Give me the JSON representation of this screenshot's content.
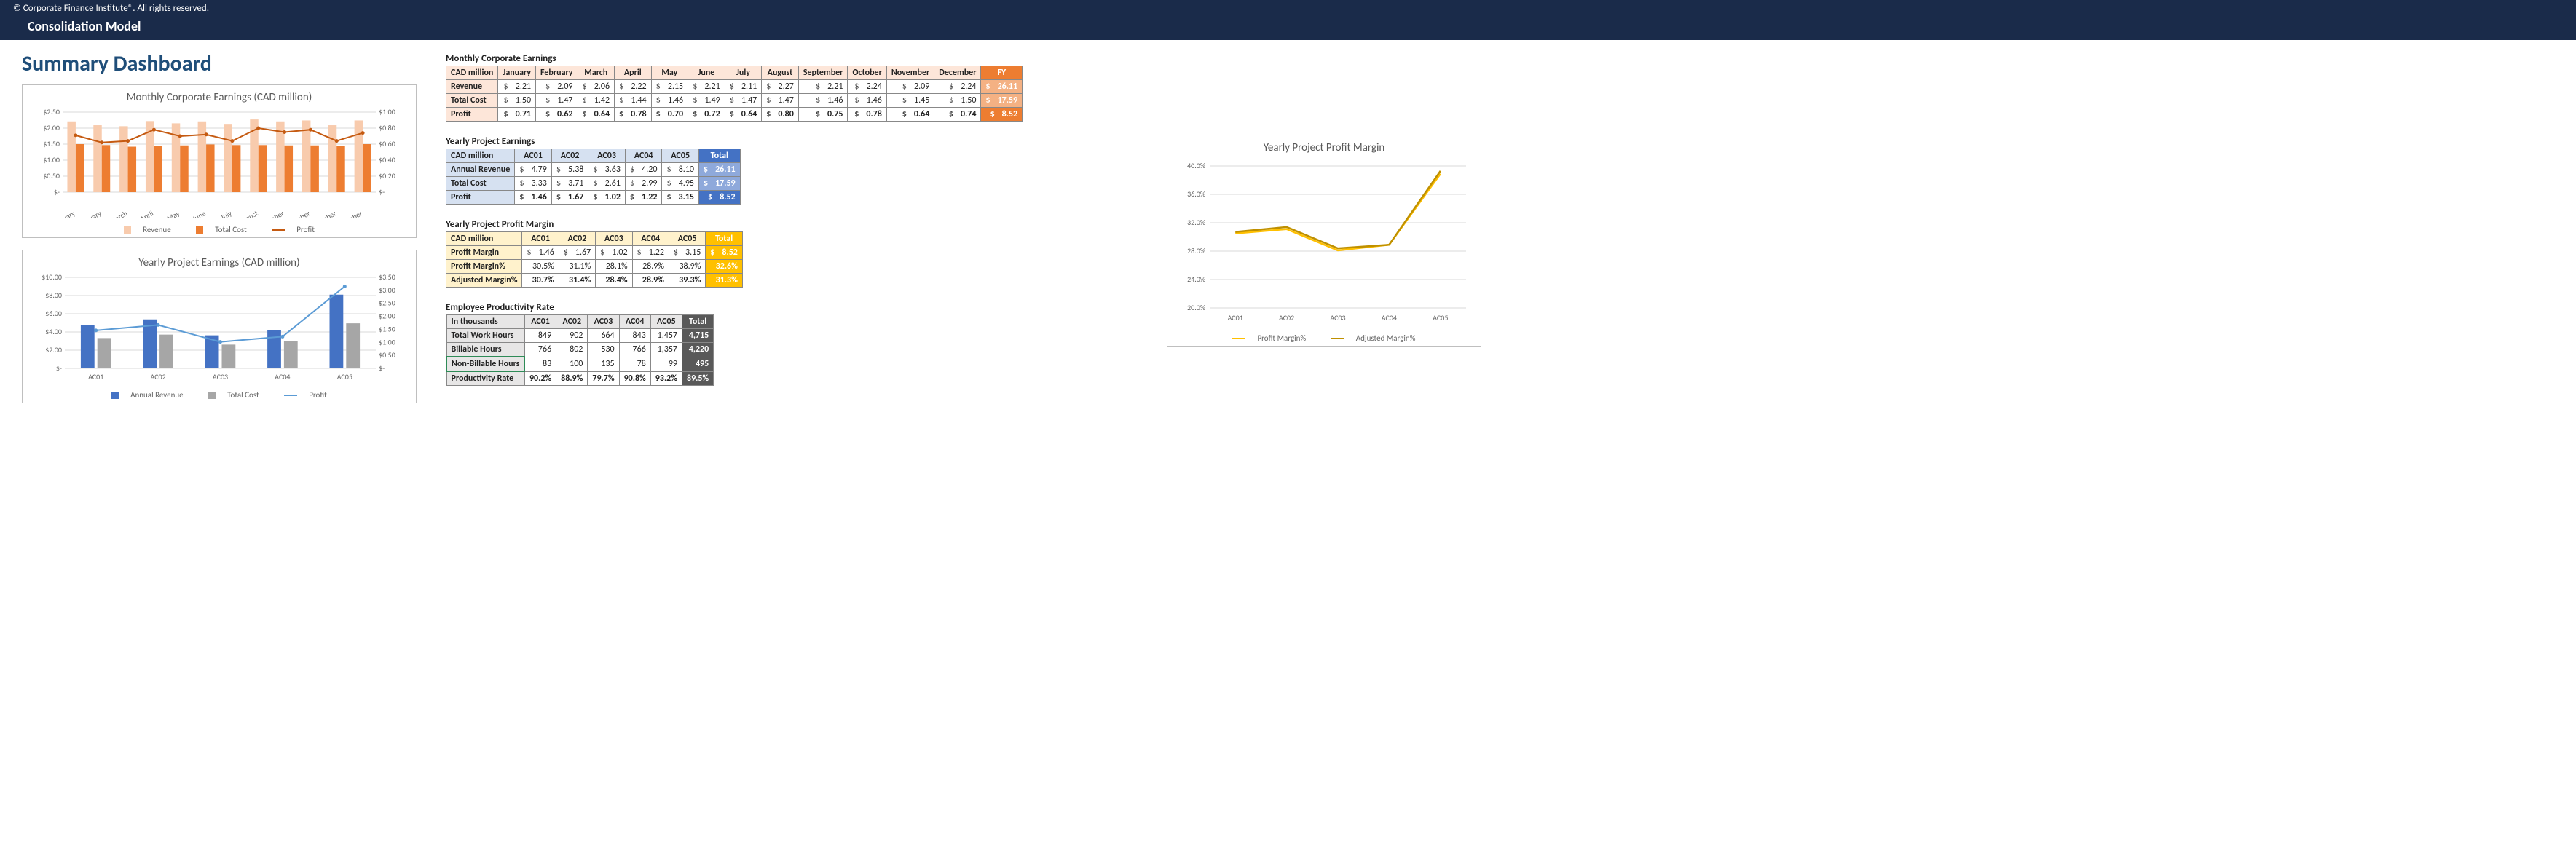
{
  "topbar": "© Corporate Finance Institute®. All rights reserved.",
  "subbar": "Consolidation Model",
  "page_title": "Summary Dashboard",
  "chart1": {
    "title": "Monthly Corporate Earnings (CAD million)",
    "legend": {
      "rev": "Revenue",
      "cost": "Total Cost",
      "profit": "Profit"
    },
    "left_ticks": [
      "$2.50",
      "$2.00",
      "$1.50",
      "$1.00",
      "$0.50",
      "$-"
    ],
    "right_ticks": [
      "$1.00",
      "$0.80",
      "$0.60",
      "$0.40",
      "$0.20",
      "$-"
    ]
  },
  "chart2": {
    "title": "Yearly Project Earnings (CAD million)",
    "legend": {
      "rev": "Annual Revenue",
      "cost": "Total Cost",
      "profit": "Profit"
    },
    "left_ticks": [
      "$10.00",
      "$8.00",
      "$6.00",
      "$4.00",
      "$2.00",
      "$-"
    ],
    "right_ticks": [
      "$3.50",
      "$3.00",
      "$2.50",
      "$2.00",
      "$1.50",
      "$1.00",
      "$0.50",
      "$-"
    ]
  },
  "chart3": {
    "title": "Yearly Project Profit Margin",
    "legend": {
      "pm": "Profit Margin%",
      "am": "Adjusted Margin%"
    },
    "y_ticks": [
      "40.0%",
      "36.0%",
      "32.0%",
      "28.0%",
      "24.0%",
      "20.0%"
    ]
  },
  "months": [
    "January",
    "February",
    "March",
    "April",
    "May",
    "June",
    "July",
    "August",
    "September",
    "October",
    "November",
    "December"
  ],
  "mce": {
    "title": "Monthly Corporate Earnings",
    "row_header": "CAD million",
    "fy_label": "FY",
    "rows": {
      "Revenue": [
        "2.21",
        "2.09",
        "2.06",
        "2.22",
        "2.15",
        "2.21",
        "2.11",
        "2.27",
        "2.21",
        "2.24",
        "2.09",
        "2.24"
      ],
      "Total Cost": [
        "1.50",
        "1.47",
        "1.42",
        "1.44",
        "1.46",
        "1.49",
        "1.47",
        "1.47",
        "1.46",
        "1.46",
        "1.45",
        "1.50"
      ],
      "Profit": [
        "0.71",
        "0.62",
        "0.64",
        "0.78",
        "0.70",
        "0.72",
        "0.64",
        "0.80",
        "0.75",
        "0.78",
        "0.64",
        "0.74"
      ]
    },
    "fy": {
      "Revenue": "26.11",
      "Total Cost": "17.59",
      "Profit": "8.52"
    }
  },
  "projects": [
    "AC01",
    "AC02",
    "AC03",
    "AC04",
    "AC05"
  ],
  "ype": {
    "title": "Yearly Project Earnings",
    "row_header": "CAD million",
    "total_label": "Total",
    "rows": {
      "Annual Revenue": [
        "4.79",
        "5.38",
        "3.63",
        "4.20",
        "8.10"
      ],
      "Total Cost": [
        "3.33",
        "3.71",
        "2.61",
        "2.99",
        "4.95"
      ],
      "Profit": [
        "1.46",
        "1.67",
        "1.02",
        "1.22",
        "3.15"
      ]
    },
    "totals": {
      "Annual Revenue": "26.11",
      "Total Cost": "17.59",
      "Profit": "8.52"
    }
  },
  "ypm": {
    "title": "Yearly Project Profit Margin",
    "row_header": "CAD million",
    "total_label": "Total",
    "rows": {
      "Profit Margin": [
        "1.46",
        "1.67",
        "1.02",
        "1.22",
        "3.15"
      ],
      "Profit Margin%": [
        "30.5%",
        "31.1%",
        "28.1%",
        "28.9%",
        "38.9%"
      ],
      "Adjusted Margin%": [
        "30.7%",
        "31.4%",
        "28.4%",
        "28.9%",
        "39.3%"
      ]
    },
    "totals": {
      "Profit Margin": "8.52",
      "Profit Margin%": "32.6%",
      "Adjusted Margin%": "31.3%"
    }
  },
  "epr": {
    "title": "Employee Productivity Rate",
    "row_header": "In thousands",
    "total_label": "Total",
    "rows": {
      "Total Work Hours": [
        "849",
        "902",
        "664",
        "843",
        "1,457"
      ],
      "Billable Hours": [
        "766",
        "802",
        "530",
        "766",
        "1,357"
      ],
      "Non-Billable Hours": [
        "83",
        "100",
        "135",
        "78",
        "99"
      ],
      "Productivity Rate": [
        "90.2%",
        "88.9%",
        "79.7%",
        "90.8%",
        "93.2%"
      ]
    },
    "totals": {
      "Total Work Hours": "4,715",
      "Billable Hours": "4,220",
      "Non-Billable Hours": "495",
      "Productivity Rate": "89.5%"
    }
  },
  "chart_data": [
    {
      "type": "bar+line",
      "title": "Monthly Corporate Earnings (CAD million)",
      "categories": [
        "January",
        "February",
        "March",
        "April",
        "May",
        "June",
        "July",
        "August",
        "September",
        "October",
        "November",
        "December"
      ],
      "series": [
        {
          "name": "Revenue",
          "axis": "left",
          "kind": "bar",
          "values": [
            2.21,
            2.09,
            2.06,
            2.22,
            2.15,
            2.21,
            2.11,
            2.27,
            2.21,
            2.24,
            2.09,
            2.24
          ]
        },
        {
          "name": "Total Cost",
          "axis": "left",
          "kind": "bar",
          "values": [
            1.5,
            1.47,
            1.42,
            1.44,
            1.46,
            1.49,
            1.47,
            1.47,
            1.46,
            1.46,
            1.45,
            1.5
          ]
        },
        {
          "name": "Profit",
          "axis": "right",
          "kind": "line",
          "values": [
            0.71,
            0.62,
            0.64,
            0.78,
            0.7,
            0.72,
            0.64,
            0.8,
            0.75,
            0.78,
            0.64,
            0.74
          ]
        }
      ],
      "ylim_left": [
        0,
        2.5
      ],
      "ylim_right": [
        0,
        1.0
      ],
      "ylabel": "$",
      "xlabel": ""
    },
    {
      "type": "bar+line",
      "title": "Yearly Project Earnings (CAD million)",
      "categories": [
        "AC01",
        "AC02",
        "AC03",
        "AC04",
        "AC05"
      ],
      "series": [
        {
          "name": "Annual Revenue",
          "axis": "left",
          "kind": "bar",
          "values": [
            4.79,
            5.38,
            3.63,
            4.2,
            8.1
          ]
        },
        {
          "name": "Total Cost",
          "axis": "left",
          "kind": "bar",
          "values": [
            3.33,
            3.71,
            2.61,
            2.99,
            4.95
          ]
        },
        {
          "name": "Profit",
          "axis": "right",
          "kind": "line",
          "values": [
            1.46,
            1.67,
            1.02,
            1.22,
            3.15
          ]
        }
      ],
      "ylim_left": [
        0,
        10
      ],
      "ylim_right": [
        0,
        3.5
      ],
      "ylabel": "$",
      "xlabel": ""
    },
    {
      "type": "line",
      "title": "Yearly Project Profit Margin",
      "categories": [
        "AC01",
        "AC02",
        "AC03",
        "AC04",
        "AC05"
      ],
      "series": [
        {
          "name": "Profit Margin%",
          "values": [
            30.5,
            31.1,
            28.1,
            28.9,
            38.9
          ]
        },
        {
          "name": "Adjusted Margin%",
          "values": [
            30.7,
            31.4,
            28.4,
            28.9,
            39.3
          ]
        }
      ],
      "ylim": [
        20,
        40
      ],
      "ylabel": "%",
      "xlabel": ""
    }
  ]
}
